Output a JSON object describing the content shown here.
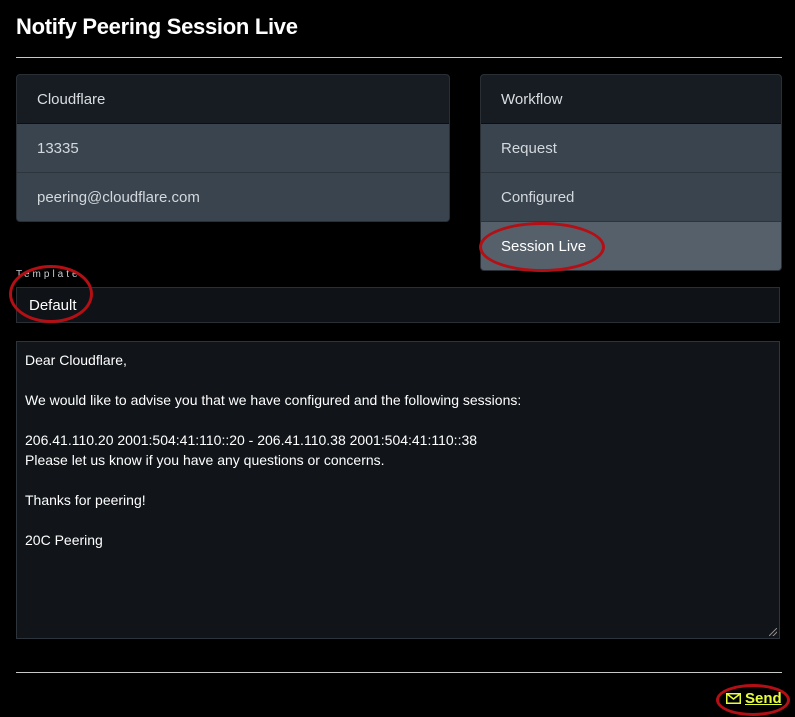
{
  "dialog": {
    "title": "Notify Peering Session Live"
  },
  "network_card": {
    "name": "Cloudflare",
    "asn": "13335",
    "email": "peering@cloudflare.com"
  },
  "workflow_card": {
    "header": "Workflow",
    "steps": [
      {
        "label": "Request",
        "active": false
      },
      {
        "label": "Configured",
        "active": false
      },
      {
        "label": "Session Live",
        "active": true
      }
    ]
  },
  "template": {
    "label": "Template",
    "selected": "Default"
  },
  "message": {
    "lines": [
      "Dear Cloudflare,",
      "",
      "We would like to advise you that we have configured and the following sessions:",
      "",
      "206.41.110.20 2001:504:41:110::20 - 206.41.110.38 2001:504:41:110::38",
      "Please let us know if you have any questions or concerns.",
      "",
      "Thanks for peering!",
      "",
      "20C Peering"
    ]
  },
  "actions": {
    "send_label": "Send",
    "send_icon": "envelope-icon"
  },
  "colors": {
    "accent_link": "#e6ff3a",
    "annotation": "#b30f14",
    "active_row": "#55606b"
  }
}
